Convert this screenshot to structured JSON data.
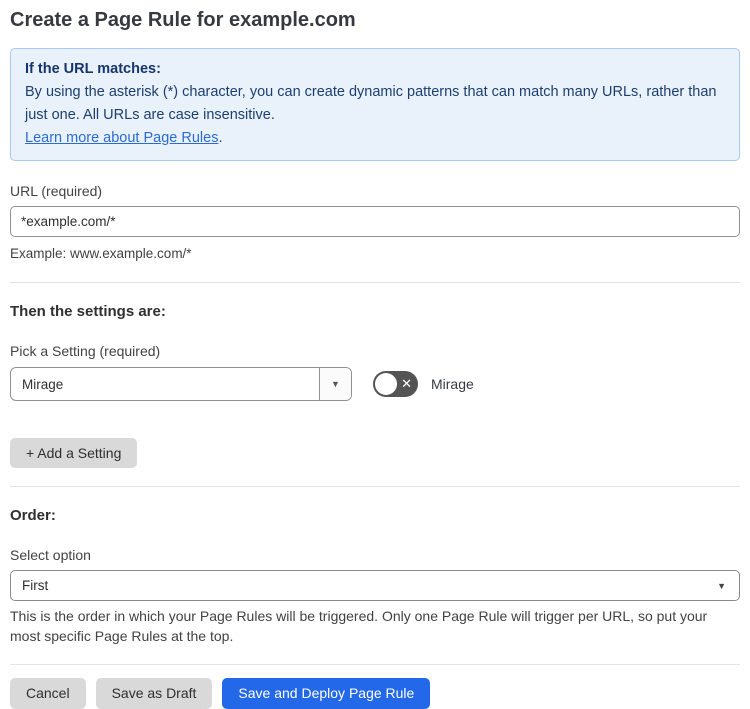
{
  "page": {
    "title": "Create a Page Rule for example.com"
  },
  "info_box": {
    "heading": "If the URL matches:",
    "body": "By using the asterisk (*) character, you can create dynamic patterns that can match many URLs, rather than just one. All URLs are case insensitive.",
    "link_label": "Learn more about Page Rules",
    "link_suffix": "."
  },
  "url_field": {
    "label": "URL (required)",
    "value": "*example.com/*",
    "hint": "Example: www.example.com/*"
  },
  "settings_section": {
    "heading": "Then the settings are:",
    "picker_label": "Pick a Setting (required)",
    "selected_setting": "Mirage",
    "toggle_label": "Mirage",
    "toggle_state": "off",
    "add_setting_label": "+ Add a Setting"
  },
  "order_section": {
    "heading": "Order:",
    "select_label": "Select option",
    "selected_option": "First",
    "hint": "This is the order in which your Page Rules will be triggered. Only one Page Rule will trigger per URL, so put your most specific Page Rules at the top."
  },
  "actions": {
    "cancel_label": "Cancel",
    "save_draft_label": "Save as Draft",
    "save_deploy_label": "Save and Deploy Page Rule"
  },
  "icons": {
    "dropdown_arrow": "▼",
    "toggle_x": "✕"
  },
  "colors": {
    "accent_blue": "#2268e8",
    "info_background": "#e9f2fb",
    "info_border": "#a9c9ef",
    "info_text": "#1d3f6f",
    "link_blue": "#2c6bd3",
    "toggle_off_gray": "#545454",
    "button_gray": "#d9d9d9"
  }
}
